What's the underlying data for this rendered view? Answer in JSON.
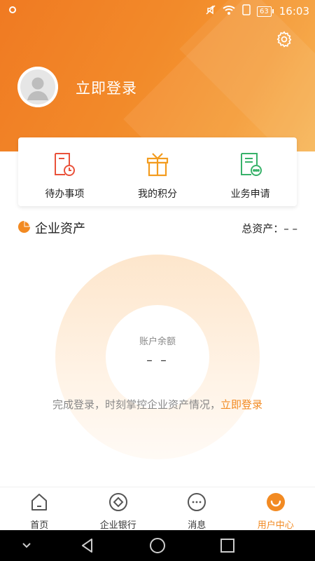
{
  "status_bar": {
    "time": "16:03",
    "battery": "63"
  },
  "header": {
    "login_label": "立即登录"
  },
  "quick_actions": [
    {
      "label": "待办事项",
      "icon": "todo-icon"
    },
    {
      "label": "我的积分",
      "icon": "gift-icon"
    },
    {
      "label": "业务申请",
      "icon": "application-icon"
    }
  ],
  "assets": {
    "title": "企业资产",
    "total_label": "总资产：",
    "total_value": "– –",
    "balance_label": "账户余额",
    "balance_value": "– –",
    "prompt_text": "完成登录，时刻掌控企业资产情况，",
    "prompt_link": "立即登录"
  },
  "tabs": [
    {
      "label": "首页",
      "icon": "home-icon",
      "active": false
    },
    {
      "label": "企业银行",
      "icon": "bank-icon",
      "active": false
    },
    {
      "label": "消息",
      "icon": "message-icon",
      "active": false
    },
    {
      "label": "用户中心",
      "icon": "user-center-icon",
      "active": true
    }
  ],
  "colors": {
    "accent": "#f28a22",
    "header_start": "#f07a22",
    "header_end": "#f7b04a"
  }
}
